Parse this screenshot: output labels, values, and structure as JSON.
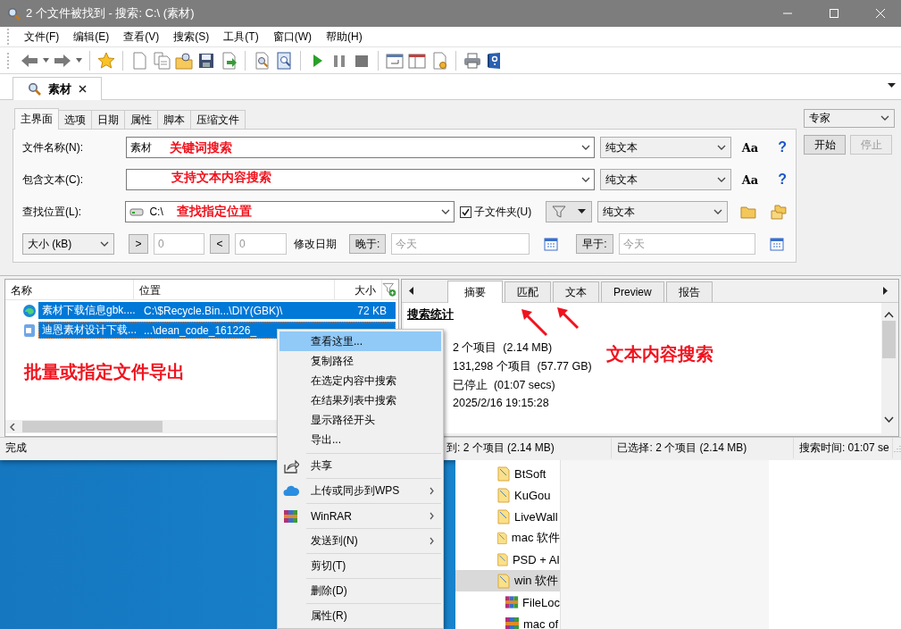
{
  "window": {
    "title": "2 个文件被找到 - 搜索: C:\\ (素材)"
  },
  "menu": [
    "文件(F)",
    "编辑(E)",
    "查看(V)",
    "搜索(S)",
    "工具(T)",
    "窗口(W)",
    "帮助(H)"
  ],
  "document_tabs": [
    {
      "label": "素材",
      "selected": true
    }
  ],
  "search_tabs": [
    {
      "label": "主界面",
      "selected": true
    },
    {
      "label": "选项",
      "selected": false
    },
    {
      "label": "日期",
      "selected": false
    },
    {
      "label": "属性",
      "selected": false
    },
    {
      "label": "脚本",
      "selected": false
    },
    {
      "label": "压缩文件",
      "selected": false
    }
  ],
  "fields": [
    {
      "label": "文件名称(N):",
      "value": "素材",
      "mode": "纯文本",
      "case_button": "Aa",
      "help": "?"
    },
    {
      "label": "包含文本(C):",
      "mode": "纯文本",
      "case_button": "Aa",
      "help": "?"
    }
  ],
  "location": {
    "label": "查找位置(L):",
    "value": "C:\\",
    "subfolders": {
      "label": "子文件夹(U)",
      "checked": true
    },
    "mode": "纯文本"
  },
  "size_filter": {
    "unit": "大小 (kB)",
    "greater_button": ">",
    "greater": "0",
    "less_button": "<",
    "less": "0",
    "date_label": "修改日期",
    "after_button": "晚于:",
    "after_placeholder": "今天",
    "before_button": "早于:",
    "before_placeholder": "今天"
  },
  "side": {
    "profile": "专家",
    "start": {
      "label": "开始",
      "disabled": false
    },
    "stop": {
      "label": "停止",
      "disabled": true
    }
  },
  "results": {
    "columns": [
      "名称",
      "位置",
      "大小"
    ],
    "rows": [
      {
        "kind": "web",
        "name": "素材下载信息gbk....",
        "location": "C:\\$Recycle.Bin...\\DIY(GBK)\\",
        "size": "72 KB",
        "selected": true
      },
      {
        "kind": "doc",
        "name": "迪恩素材设计下载...",
        "location": "...\\dean_code_161226_",
        "selected": true
      }
    ]
  },
  "preview": {
    "tabs": [
      {
        "label": "摘要",
        "selected": true
      },
      {
        "label": "匹配",
        "selected": false
      },
      {
        "label": "文本",
        "selected": false
      },
      {
        "label": "Preview",
        "selected": false
      },
      {
        "label": "报告",
        "selected": false
      }
    ],
    "heading": "搜索统计",
    "lines": [
      "2 个项目  (2.14 MB)",
      "131,298 个项目  (57.77 GB)",
      "已停止  (01:07 secs)",
      "2025/2/16 19:15:28"
    ]
  },
  "status_bar": [
    "完成",
    "到: 2 个项目 (2.14 MB)",
    "已选择: 2 个项目 (2.14 MB)",
    "搜索时间: 01:07 se"
  ],
  "context_menu": [
    {
      "label": "查看这里...",
      "kind": "plain",
      "selected": true,
      "submenu": false,
      "separator_before": false
    },
    {
      "label": "复制路径",
      "kind": "plain",
      "selected": false,
      "submenu": false,
      "separator_before": false
    },
    {
      "label": "在选定内容中搜索",
      "kind": "plain",
      "selected": false,
      "submenu": false,
      "separator_before": false
    },
    {
      "label": "在结果列表中搜索",
      "kind": "plain",
      "selected": false,
      "submenu": false,
      "separator_before": false
    },
    {
      "label": "显示路径开头",
      "kind": "plain",
      "selected": false,
      "submenu": false,
      "separator_before": false
    },
    {
      "label": "导出...",
      "kind": "plain",
      "selected": false,
      "submenu": false,
      "separator_before": false
    },
    {
      "label": "共享",
      "kind": "share",
      "selected": false,
      "submenu": false,
      "separator_before": true
    },
    {
      "label": "上传或同步到WPS",
      "kind": "cloud",
      "selected": false,
      "submenu": true,
      "separator_before": true
    },
    {
      "label": "WinRAR",
      "kind": "archive",
      "selected": false,
      "submenu": true,
      "separator_before": true
    },
    {
      "label": "发送到(N)",
      "kind": "plain",
      "selected": false,
      "submenu": true,
      "separator_before": true
    },
    {
      "label": "剪切(T)",
      "kind": "plain",
      "selected": false,
      "submenu": false,
      "separator_before": true
    },
    {
      "label": "删除(D)",
      "kind": "plain",
      "selected": false,
      "submenu": false,
      "separator_before": true
    },
    {
      "label": "属性(R)",
      "kind": "plain",
      "selected": false,
      "submenu": false,
      "separator_before": true
    }
  ],
  "explorer": {
    "items": [
      {
        "label": "BtSoft",
        "kind": "folder",
        "selected": false
      },
      {
        "label": "KuGou",
        "kind": "folder",
        "selected": false
      },
      {
        "label": "LiveWall",
        "kind": "folder",
        "selected": false
      },
      {
        "label": "mac 软件",
        "kind": "folder",
        "selected": false
      },
      {
        "label": "PSD + AI",
        "kind": "folder",
        "selected": false
      },
      {
        "label": "win 软件",
        "kind": "folder",
        "selected": true
      },
      {
        "label": "FileLoc",
        "kind": "archive",
        "selected": false
      },
      {
        "label": "mac of",
        "kind": "archive",
        "selected": false
      }
    ]
  },
  "annotations": [
    {
      "text": "关键词搜索"
    },
    {
      "text": "支持文本内容搜索"
    },
    {
      "text": "查找指定位置"
    },
    {
      "text": "批量或指定文件导出"
    },
    {
      "text": "文本内容搜索"
    }
  ]
}
